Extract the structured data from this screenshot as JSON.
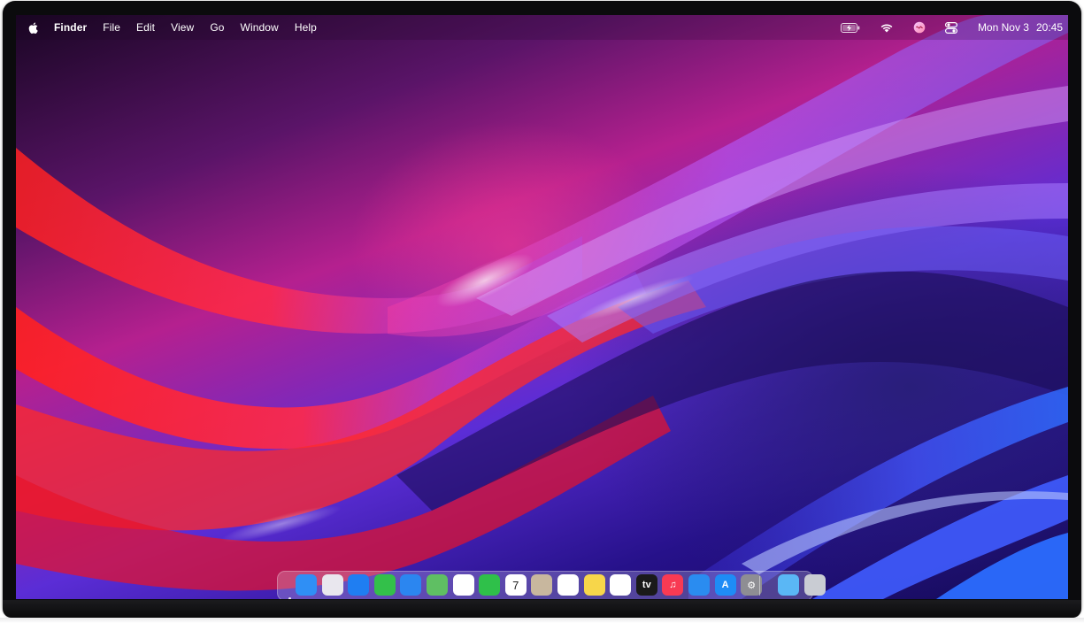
{
  "menubar": {
    "app_name": "Finder",
    "menus": [
      "File",
      "Edit",
      "View",
      "Go",
      "Window",
      "Help"
    ],
    "status_icons": [
      "battery-charging-icon",
      "wifi-icon",
      "siri-icon",
      "control-center-icon"
    ],
    "clock": {
      "day_date": "Mon Nov 3",
      "time": "20:45"
    }
  },
  "dock": {
    "apps": [
      {
        "name": "finder-icon",
        "color": "#2f8ff5",
        "glyph": ""
      },
      {
        "name": "launchpad-icon",
        "color": "#e9e7ee",
        "glyph": ""
      },
      {
        "name": "safari-icon",
        "color": "#1f7ef2",
        "glyph": ""
      },
      {
        "name": "messages-icon",
        "color": "#33c04a",
        "glyph": ""
      },
      {
        "name": "mail-icon",
        "color": "#2b86f0",
        "glyph": ""
      },
      {
        "name": "maps-icon",
        "color": "#5fbf63",
        "glyph": ""
      },
      {
        "name": "photos-icon",
        "color": "#ffffff",
        "glyph": ""
      },
      {
        "name": "facetime-icon",
        "color": "#2fc04a",
        "glyph": ""
      },
      {
        "name": "calendar-icon",
        "color": "#ffffff",
        "glyph": "7"
      },
      {
        "name": "contacts-icon",
        "color": "#c8b79e",
        "glyph": ""
      },
      {
        "name": "reminders-icon",
        "color": "#ffffff",
        "glyph": ""
      },
      {
        "name": "notes-icon",
        "color": "#f7d64a",
        "glyph": ""
      },
      {
        "name": "freeform-icon",
        "color": "#ffffff",
        "glyph": ""
      },
      {
        "name": "apple-tv-icon",
        "color": "#1a1a1a",
        "glyph": "tv"
      },
      {
        "name": "music-icon",
        "color": "#f83a53",
        "glyph": "♫"
      },
      {
        "name": "keynote-icon",
        "color": "#2a8cf0",
        "glyph": ""
      },
      {
        "name": "app-store-icon",
        "color": "#1e8cf6",
        "glyph": "A"
      },
      {
        "name": "system-settings-icon",
        "color": "#8e8e93",
        "glyph": "⚙"
      }
    ],
    "extras": [
      {
        "name": "downloads-folder-icon",
        "color": "#5ab7f5",
        "glyph": ""
      },
      {
        "name": "trash-icon",
        "color": "#c9ccd3",
        "glyph": ""
      }
    ]
  }
}
